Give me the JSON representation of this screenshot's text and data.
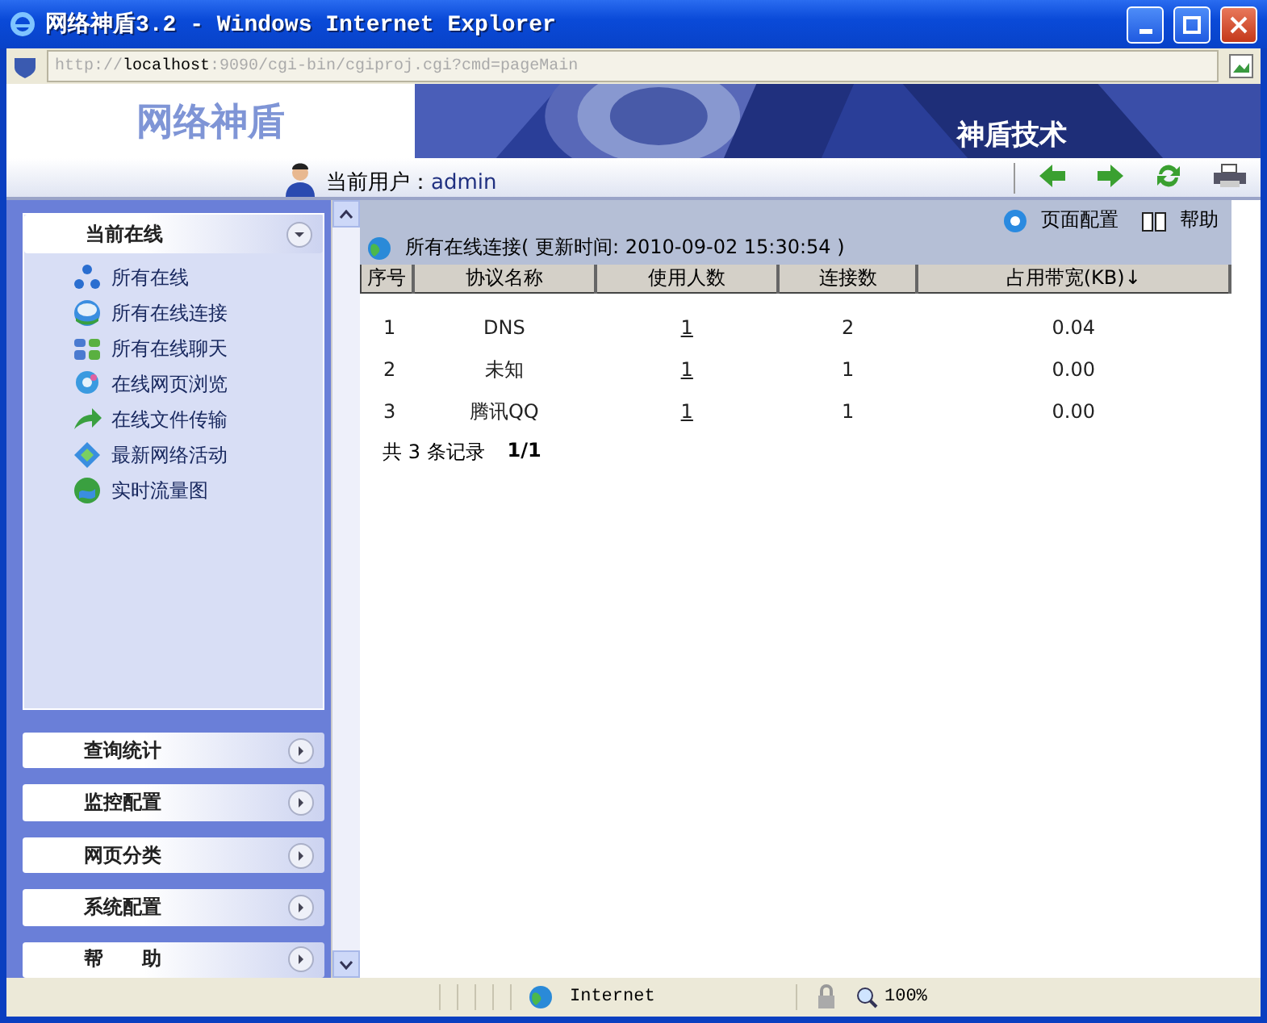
{
  "window": {
    "title": "网络神盾3.2 - Windows Internet Explorer"
  },
  "address_bar": {
    "url_prefix": "http://",
    "url_host": "localhost",
    "url_rest": ":9090/cgi-bin/cgiproj.cgi?cmd=pageMain"
  },
  "header": {
    "logo": "网络神盾",
    "banner_text": "神盾技术"
  },
  "user_bar": {
    "label": "当前用户：",
    "user": "admin"
  },
  "sidebar": {
    "sections": [
      {
        "title": "当前在线",
        "expanded": true,
        "items": [
          "所有在线",
          "所有在线连接",
          "所有在线聊天",
          "在线网页浏览",
          "在线文件传输",
          "最新网络活动",
          "实时流量图"
        ]
      },
      {
        "title": "查询统计",
        "expanded": false
      },
      {
        "title": "监控配置",
        "expanded": false
      },
      {
        "title": "网页分类",
        "expanded": false
      },
      {
        "title": "系统配置",
        "expanded": false
      },
      {
        "title": "帮　　助",
        "expanded": false
      }
    ]
  },
  "toolbar": {
    "page_config": "页面配置",
    "help": "帮助"
  },
  "panel": {
    "title": "所有在线连接( 更新时间: 2010-09-02 15:30:54 )"
  },
  "table": {
    "columns": [
      "序号",
      "协议名称",
      "使用人数",
      "连接数",
      "占用带宽(KB)↓"
    ],
    "rows": [
      [
        "1",
        "DNS",
        "1",
        "2",
        "0.04"
      ],
      [
        "2",
        "未知",
        "1",
        "1",
        "0.00"
      ],
      [
        "3",
        "腾讯QQ",
        "1",
        "1",
        "0.00"
      ]
    ]
  },
  "pager": {
    "summary": "共 3 条记录",
    "page": "1/1"
  },
  "status_bar": {
    "zone": "Internet",
    "zoom": "100%"
  }
}
